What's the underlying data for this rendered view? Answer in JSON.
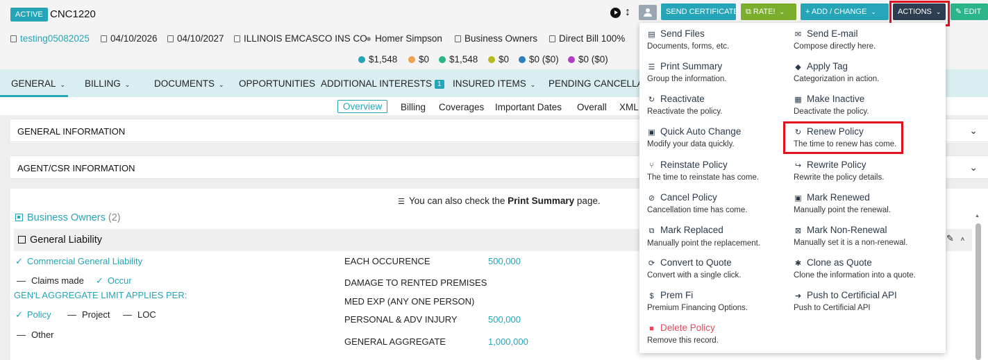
{
  "header": {
    "status": "ACTIVE",
    "policy_number": "CNC1220",
    "buttons": {
      "send_certificate": "SEND CERTIFICATE",
      "rate": "RATE!",
      "add_change": "+ ADD / CHANGE",
      "actions": "ACTIONS",
      "edit": "EDIT"
    }
  },
  "meta": {
    "client": "testing05082025",
    "effective_date": "04/10/2026",
    "expiration_date": "04/10/2027",
    "carrier": "ILLINOIS EMCASCO INS CO",
    "agent": "Homer Simpson",
    "line": "Business Owners",
    "billing": "Direct Bill 100%"
  },
  "money": [
    {
      "value": "$1,548",
      "color": "#26a4b8"
    },
    {
      "value": "$0",
      "color": "#f0a050"
    },
    {
      "value": "$1,548",
      "color": "#2bb38a"
    },
    {
      "value": "$0",
      "color": "#b8b820"
    },
    {
      "value": "$0 ($0)",
      "color": "#2a7fc0"
    },
    {
      "value": "$0 ($0)",
      "color": "#b040c0"
    }
  ],
  "nav": {
    "general": "GENERAL",
    "billing": "BILLING",
    "documents": "DOCUMENTS",
    "opportunities": "OPPORTUNITIES",
    "additional_interests": "ADDITIONAL INTERESTS",
    "additional_interests_count": "1",
    "insured_items": "INSURED ITEMS",
    "pending": "PENDING CANCELLAT"
  },
  "subtabs": {
    "overview": "Overview",
    "billing": "Billing",
    "coverages": "Coverages",
    "important_dates": "Important Dates",
    "overall": "Overall",
    "xml": "XML"
  },
  "sections": {
    "general_info": "GENERAL INFORMATION",
    "agent_csr": "AGENT/CSR INFORMATION"
  },
  "content": {
    "print_note_prefix": "You can also check the",
    "print_note_bold": "Print Summary",
    "print_note_suffix": "page.",
    "bo_title": "Business Owners",
    "bo_count": "(2)",
    "gl_title": "General Liability",
    "cgl": "Commercial General Liability",
    "claims_made": "Claims made",
    "occur": "Occur",
    "aggregate_applies": "GEN'L AGGREGATE LIMIT APPLIES PER:",
    "policy": "Policy",
    "project": "Project",
    "loc": "LOC",
    "other": "Other",
    "limits": [
      {
        "label": "EACH OCCURENCE",
        "value": "500,000"
      },
      {
        "label": "DAMAGE TO RENTED PREMISES",
        "value": ""
      },
      {
        "label": "MED EXP (ANY ONE PERSON)",
        "value": ""
      },
      {
        "label": "PERSONAL & ADV INJURY",
        "value": "500,000"
      },
      {
        "label": "GENERAL AGGREGATE",
        "value": "1,000,000"
      }
    ]
  },
  "menu": {
    "left": [
      {
        "title": "Send Files",
        "desc": "Documents, forms, etc.",
        "icon": "file-icon"
      },
      {
        "title": "Print Summary",
        "desc": "Group the information.",
        "icon": "list-icon"
      },
      {
        "title": "Reactivate",
        "desc": "Reactivate the policy.",
        "icon": "reactivate-icon"
      },
      {
        "title": "Quick Auto Change",
        "desc": "Modify your data quickly.",
        "icon": "edit-icon"
      },
      {
        "title": "Reinstate Policy",
        "desc": "The time to reinstate has come.",
        "icon": "branch-icon"
      },
      {
        "title": "Cancel Policy",
        "desc": "Cancellation time has come.",
        "icon": "ban-icon"
      },
      {
        "title": "Mark Replaced",
        "desc": "Manually point the replacement.",
        "icon": "copy-icon"
      },
      {
        "title": "Convert to Quote",
        "desc": "Convert with a single click.",
        "icon": "refresh-icon"
      },
      {
        "title": "Prem Fi",
        "desc": "Premium Financing Options.",
        "icon": "dollar-icon"
      },
      {
        "title": "Delete Policy",
        "desc": "Remove this record.",
        "icon": "trash-icon"
      }
    ],
    "right": [
      {
        "title": "Send E-mail",
        "desc": "Compose directly here.",
        "icon": "envelope-icon"
      },
      {
        "title": "Apply Tag",
        "desc": "Categorization in action.",
        "icon": "tag-icon"
      },
      {
        "title": "Make Inactive",
        "desc": "Deactivate the policy.",
        "icon": "archive-icon"
      },
      {
        "title": "Renew Policy",
        "desc": "The time to renew has come.",
        "icon": "renew-icon"
      },
      {
        "title": "Rewrite Policy",
        "desc": "Rewrite the policy details.",
        "icon": "redo-icon"
      },
      {
        "title": "Mark Renewed",
        "desc": "Manually point the renewal.",
        "icon": "check-square-icon"
      },
      {
        "title": "Mark Non-Renewal",
        "desc": "Manually set it is a non-renewal.",
        "icon": "non-renewal-icon"
      },
      {
        "title": "Clone as Quote",
        "desc": "Clone the information into a quote.",
        "icon": "asterisk-icon"
      },
      {
        "title": "Push to Certificial API",
        "desc": "Push to Certificial API",
        "icon": "push-icon"
      }
    ]
  }
}
